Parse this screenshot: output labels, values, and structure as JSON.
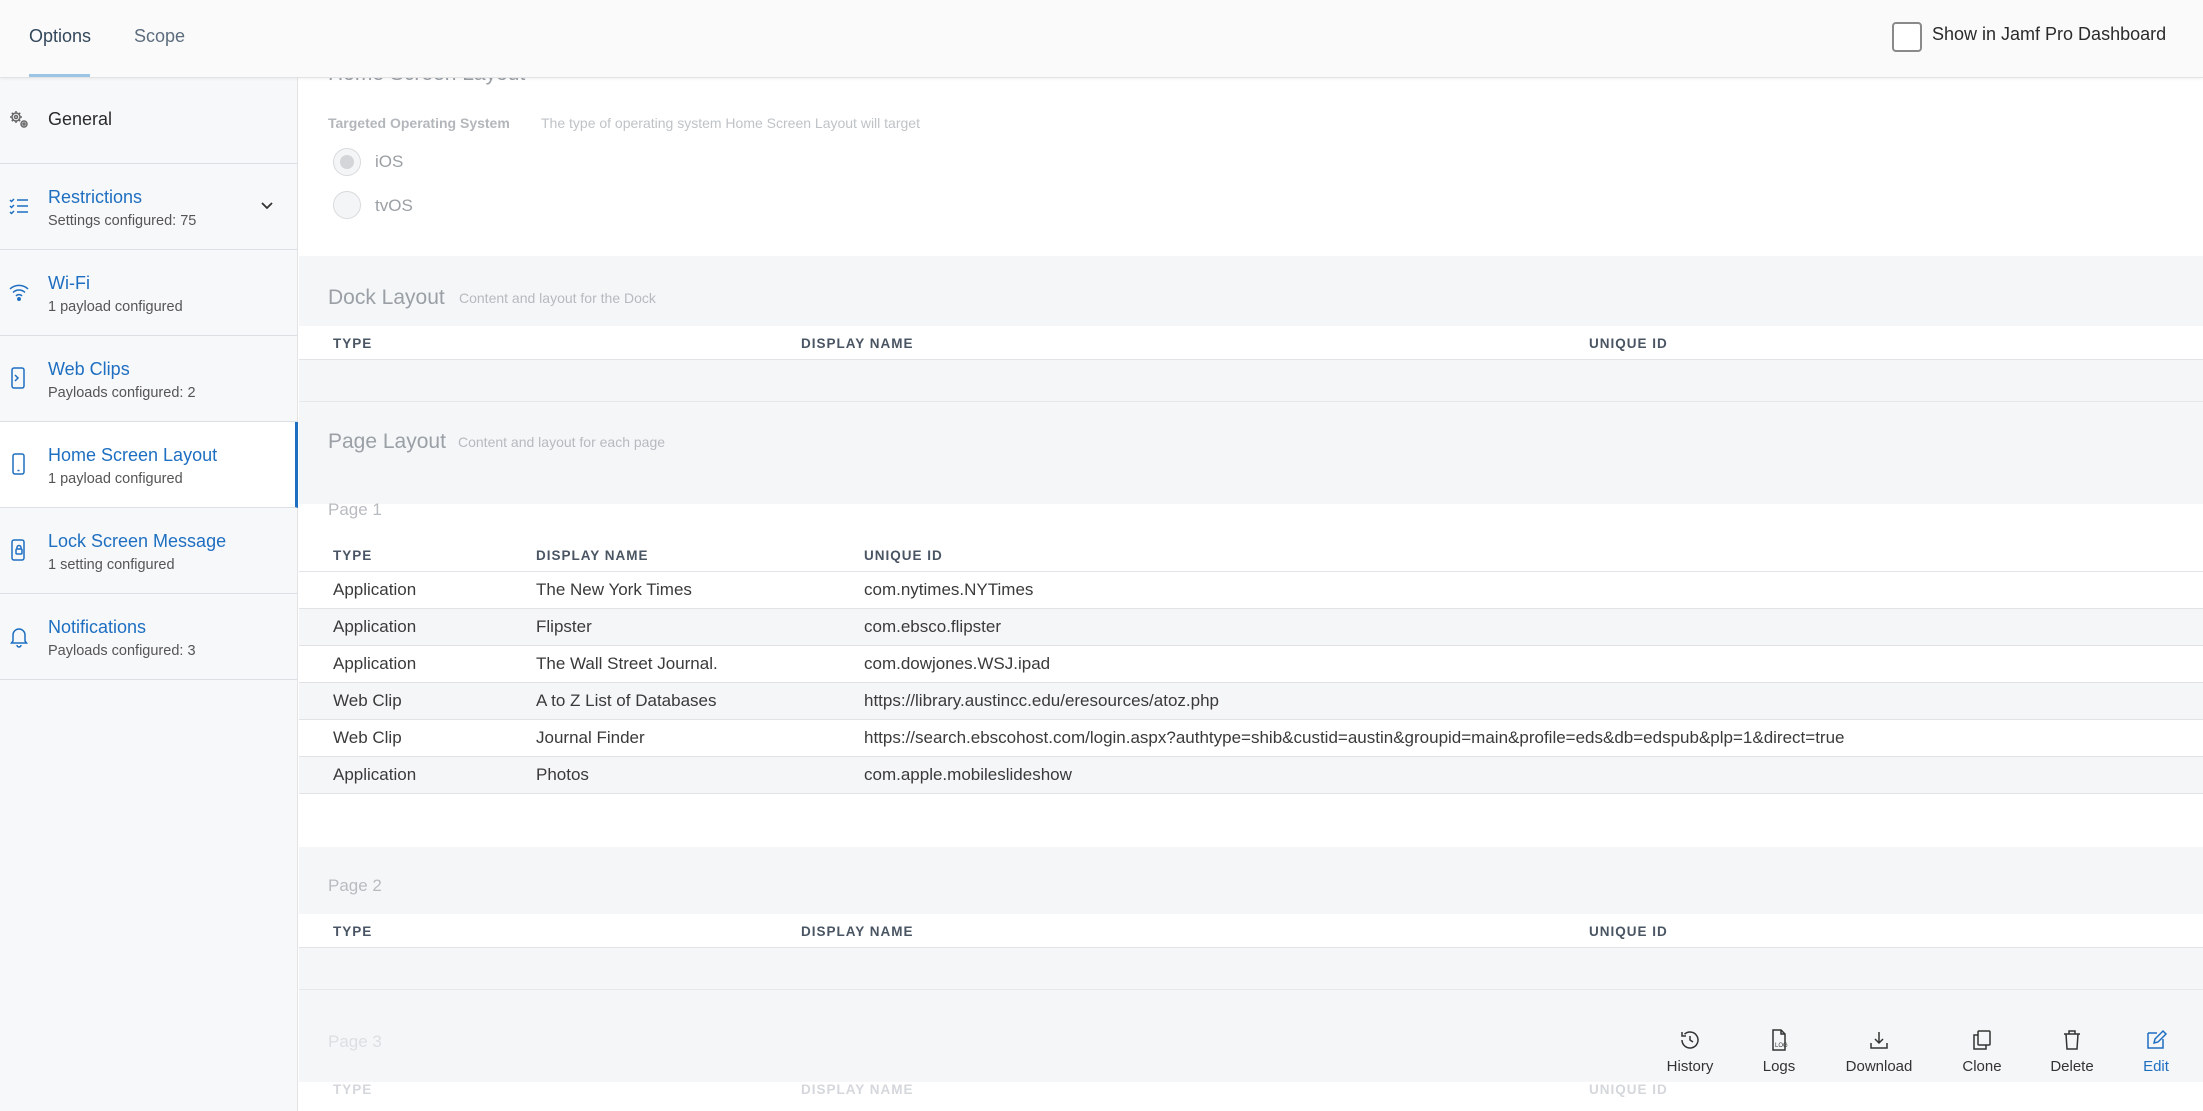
{
  "topbar": {
    "tabs": [
      "Options",
      "Scope"
    ],
    "dashboard_label": "Show in Jamf Pro Dashboard"
  },
  "sidebar": {
    "items": [
      {
        "label": "General",
        "subtitle": ""
      },
      {
        "label": "Restrictions",
        "subtitle": "Settings configured: 75"
      },
      {
        "label": "Wi-Fi",
        "subtitle": "1 payload configured"
      },
      {
        "label": "Web Clips",
        "subtitle": "Payloads configured: 2"
      },
      {
        "label": "Home Screen Layout",
        "subtitle": "1 payload configured"
      },
      {
        "label": "Lock Screen Message",
        "subtitle": "1 setting configured"
      },
      {
        "label": "Notifications",
        "subtitle": "Payloads configured: 3"
      }
    ]
  },
  "main": {
    "section_title": "Home Screen Layout",
    "targeted_os": {
      "label": "Targeted Operating System",
      "description": "The type of operating system Home Screen Layout will target",
      "options": [
        "iOS",
        "tvOS"
      ]
    },
    "dock": {
      "title": "Dock Layout",
      "description": "Content and layout for the Dock",
      "columns": [
        "TYPE",
        "DISPLAY NAME",
        "UNIQUE ID"
      ]
    },
    "page_layout": {
      "title": "Page Layout",
      "description": "Content and layout for each page",
      "page1": {
        "label": "Page 1",
        "columns": [
          "TYPE",
          "DISPLAY NAME",
          "UNIQUE ID"
        ],
        "rows": [
          {
            "type": "Application",
            "name": "The New York Times",
            "id": "com.nytimes.NYTimes"
          },
          {
            "type": "Application",
            "name": "Flipster",
            "id": "com.ebsco.flipster"
          },
          {
            "type": "Application",
            "name": "The Wall Street Journal.",
            "id": "com.dowjones.WSJ.ipad"
          },
          {
            "type": "Web Clip",
            "name": "A to Z List of Databases",
            "id": "https://library.austincc.edu/eresources/atoz.php"
          },
          {
            "type": "Web Clip",
            "name": "Journal Finder",
            "id": "https://search.ebscohost.com/login.aspx?authtype=shib&custid=austin&groupid=main&profile=eds&db=edspub&plp=1&direct=true"
          },
          {
            "type": "Application",
            "name": "Photos",
            "id": "com.apple.mobileslideshow"
          }
        ]
      },
      "page2": {
        "label": "Page 2",
        "columns": [
          "TYPE",
          "DISPLAY NAME",
          "UNIQUE ID"
        ]
      },
      "page3": {
        "label": "Page 3",
        "columns": [
          "TYPE",
          "DISPLAY NAME",
          "UNIQUE ID"
        ]
      }
    }
  },
  "toolbar": {
    "history": "History",
    "logs": "Logs",
    "download": "Download",
    "clone": "Clone",
    "delete": "Delete",
    "edit": "Edit"
  },
  "colors": {
    "accent": "#1e6fc1",
    "sidebar_bg": "#f7f8fa",
    "band_bg": "#f5f6f8"
  }
}
